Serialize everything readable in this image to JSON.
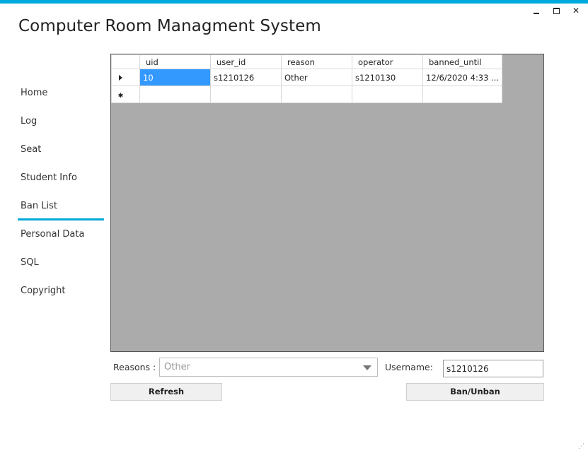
{
  "window": {
    "title": "Computer Room Managment System",
    "controls": {
      "minimize": "_",
      "maximize": "□",
      "close": "✕"
    },
    "accent_color": "#00aadd"
  },
  "nav": {
    "items": [
      {
        "label": "Home"
      },
      {
        "label": "Log"
      },
      {
        "label": "Seat"
      },
      {
        "label": "Student Info"
      },
      {
        "label": "Ban List"
      },
      {
        "label": "Personal Data"
      },
      {
        "label": "SQL"
      },
      {
        "label": "Copyright"
      }
    ],
    "active": "Ban List"
  },
  "grid": {
    "columns": [
      "uid",
      "user_id",
      "reason",
      "operator",
      "banned_until"
    ],
    "rows": [
      [
        "10",
        "s1210126",
        "Other",
        "s1210130",
        "12/6/2020 4:33 ..."
      ]
    ],
    "selection_color": "#3399ff"
  },
  "form": {
    "reasons_label": "Reasons :",
    "reasons_value": "Other",
    "username_label": "Username:",
    "username_value": "s1210126",
    "refresh_label": "Refresh",
    "ban_label": "Ban/Unban"
  }
}
